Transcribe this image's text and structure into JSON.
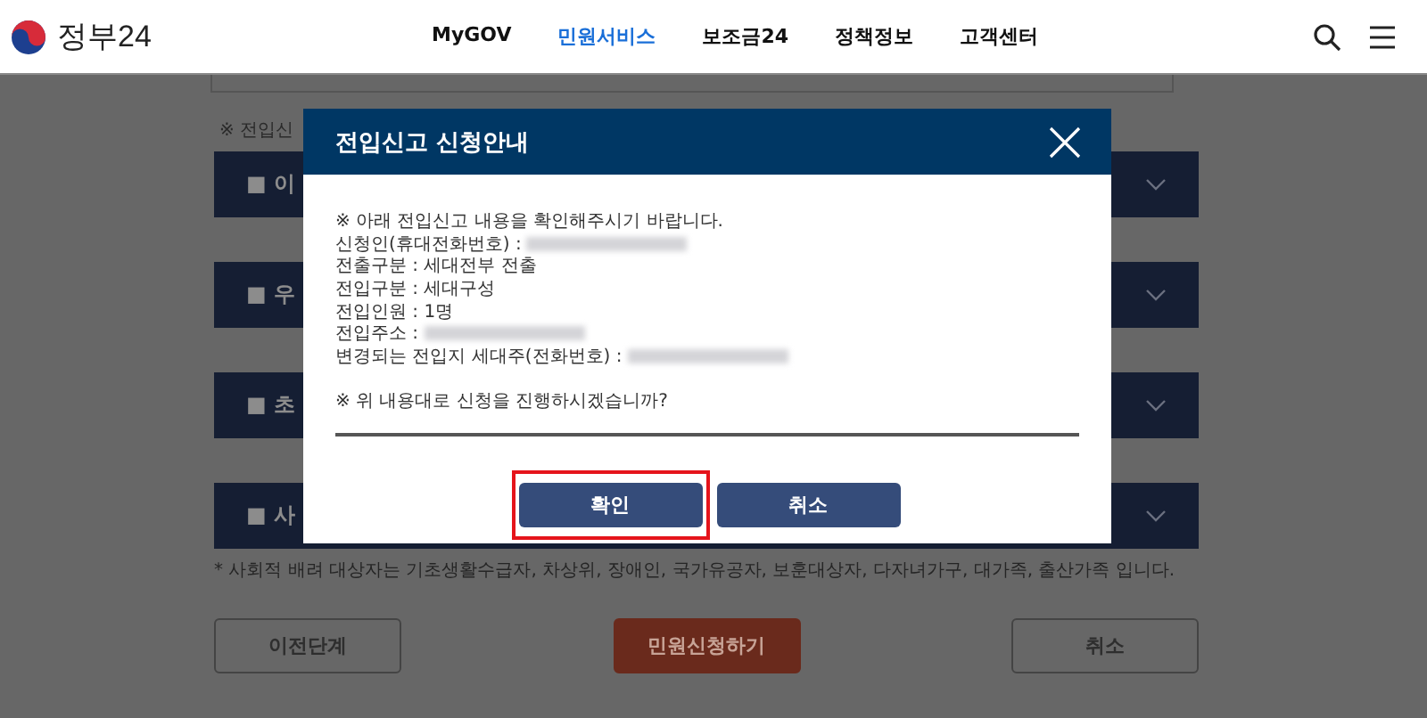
{
  "header": {
    "logo_text": "정부24",
    "nav": [
      {
        "label": "MyGOV",
        "selected": false
      },
      {
        "label": "민원서비스",
        "selected": true
      },
      {
        "label": "보조금24",
        "selected": false
      },
      {
        "label": "정책정보",
        "selected": false
      },
      {
        "label": "고객센터",
        "selected": false
      }
    ]
  },
  "page": {
    "notice": "※ 전입신",
    "sections": [
      {
        "label": "■ 이"
      },
      {
        "label": "■ 우"
      },
      {
        "label": "■ 초"
      },
      {
        "label": "■ 사"
      }
    ],
    "footnote": "* 사회적 배려 대상자는 기초생활수급자, 차상위, 장애인, 국가유공자, 보훈대상자, 다자녀가구, 대가족, 출산가족 입니다.",
    "buttons": [
      {
        "label": "이전단계",
        "kind": "secondary"
      },
      {
        "label": "민원신청하기",
        "kind": "primary"
      },
      {
        "label": "취소",
        "kind": "secondary"
      }
    ]
  },
  "modal": {
    "title": "전입신고 신청안내",
    "lines": [
      {
        "text": "※ 아래 전입신고 내용을 확인해주시기 바랍니다.",
        "redacted": false
      },
      {
        "text": "신청인(휴대전화번호) :",
        "redacted": true
      },
      {
        "text": "전출구분 : 세대전부 전출",
        "redacted": false
      },
      {
        "text": "전입구분 : 세대구성",
        "redacted": false
      },
      {
        "text": "전입인원 : 1명",
        "redacted": false
      },
      {
        "text": "전입주소 :",
        "redacted": true
      },
      {
        "text": "변경되는 전입지 세대주(전화번호) :",
        "redacted": true
      }
    ],
    "question": "※ 위 내용대로 신청을 진행하시겠습니까?",
    "buttons": [
      {
        "label": "확인",
        "highlighted": true
      },
      {
        "label": "취소",
        "highlighted": false
      }
    ]
  }
}
